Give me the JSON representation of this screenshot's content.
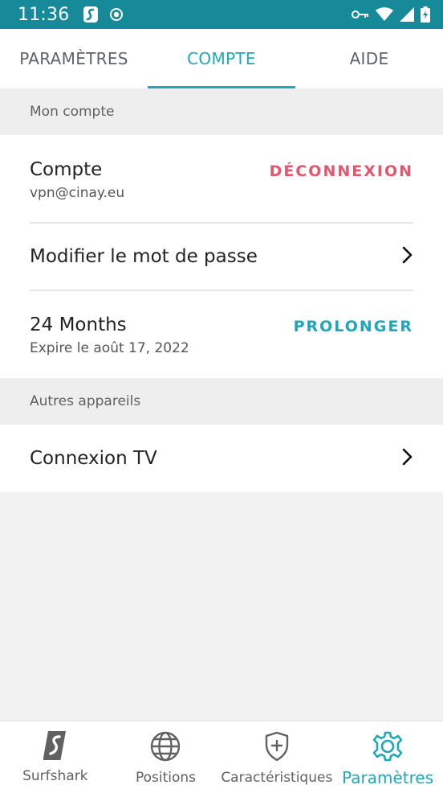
{
  "status_bar": {
    "time": "11:36",
    "icons": [
      "surfshark-logo-icon",
      "record-icon",
      "vpn-key-icon",
      "wifi-icon",
      "signal-icon",
      "battery-charging-icon"
    ]
  },
  "tabs": [
    {
      "label": "PARAMÈTRES",
      "active": false
    },
    {
      "label": "COMPTE",
      "active": true
    },
    {
      "label": "AIDE",
      "active": false
    }
  ],
  "sections": {
    "account_header": "Mon compte",
    "other_devices_header": "Autres appareils"
  },
  "account": {
    "title": "Compte",
    "email": "vpn@cinay.eu",
    "logout_label": "DÉCONNEXION"
  },
  "password": {
    "title": "Modifier le mot de passe"
  },
  "subscription": {
    "title": "24 Months",
    "expires": "Expire le août 17, 2022",
    "extend_label": "PROLONGER"
  },
  "tv": {
    "title": "Connexion TV"
  },
  "bottom_nav": [
    {
      "label": "Surfshark",
      "icon": "surfshark-logo-icon",
      "active": false
    },
    {
      "label": "Positions",
      "icon": "globe-icon",
      "active": false
    },
    {
      "label": "Caractéristiques",
      "icon": "shield-plus-icon",
      "active": false
    },
    {
      "label": "Paramètres",
      "icon": "gear-icon",
      "active": true
    }
  ],
  "colors": {
    "status_bar": "#178a9a",
    "accent": "#1ea7b8",
    "logout_red": "#e5566d"
  }
}
